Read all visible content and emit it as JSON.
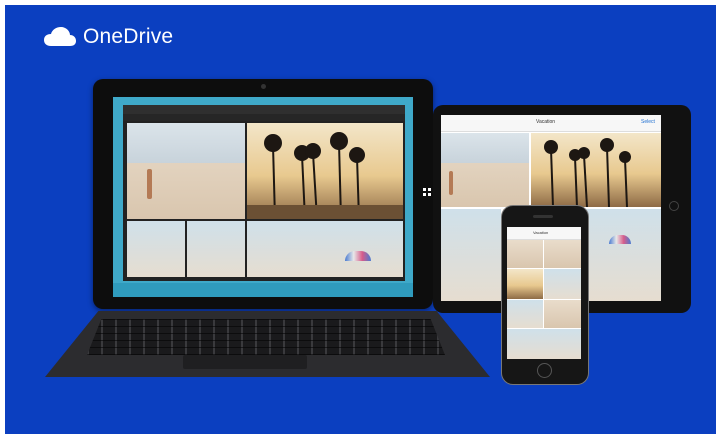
{
  "brand": {
    "name": "OneDrive",
    "icon": "cloud-icon"
  },
  "colors": {
    "background": "#0b3fc0",
    "accent": "#3fa9c9"
  },
  "tablet": {
    "device": "Surface",
    "icons": [
      "windows-logo-icon"
    ]
  },
  "ipad": {
    "header_title": "Vacation",
    "header_action": "Select"
  },
  "phone": {
    "header_title": "Vacation"
  }
}
